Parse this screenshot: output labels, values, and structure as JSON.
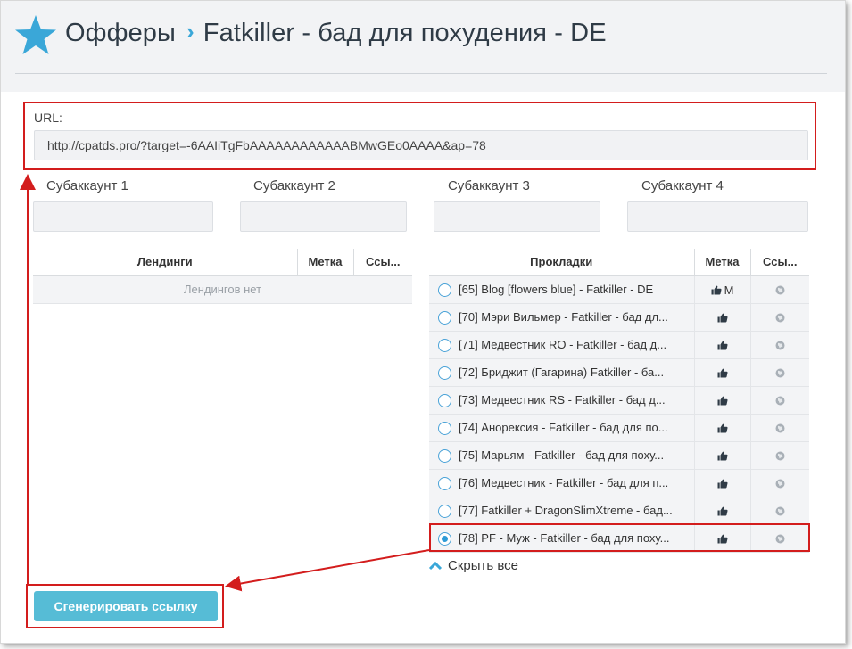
{
  "breadcrumb": {
    "root": "Офферы",
    "separator": "›",
    "current": "Fatkiller - бад для похудения - DE"
  },
  "url": {
    "label": "URL:",
    "value": "http://cpatds.pro/?target=-6AAIiTgFbAAAAAAAAAAAABMwGEo0AAAA&ap=78"
  },
  "subaccounts": [
    {
      "label": "Субаккаунт 1",
      "value": ""
    },
    {
      "label": "Субаккаунт 2",
      "value": ""
    },
    {
      "label": "Субаккаунт 3",
      "value": ""
    },
    {
      "label": "Субаккаунт 4",
      "value": ""
    }
  ],
  "landings": {
    "headers": [
      "Лендинги",
      "Метка",
      "Ссы..."
    ],
    "empty_text": "Лендингов нет"
  },
  "prelandings": {
    "headers": [
      "Прокладки",
      "Метка",
      "Ссы..."
    ],
    "rows": [
      {
        "name": "[65] Blog [flowers blue] - Fatkiller - DE",
        "mark": "M",
        "selected": false
      },
      {
        "name": "[70] Мэри Вильмер - Fatkiller - бад дл...",
        "mark": "",
        "selected": false
      },
      {
        "name": "[71] Медвестник RO - Fatkiller - бад д...",
        "mark": "",
        "selected": false
      },
      {
        "name": "[72] Бриджит (Гагарина) Fatkiller - ба...",
        "mark": "",
        "selected": false
      },
      {
        "name": "[73] Медвестник RS - Fatkiller - бад д...",
        "mark": "",
        "selected": false
      },
      {
        "name": "[74] Анорексия - Fatkiller - бад для по...",
        "mark": "",
        "selected": false
      },
      {
        "name": "[75] Марьям - Fatkiller - бад для поху...",
        "mark": "",
        "selected": false
      },
      {
        "name": "[76] Медвестник - Fatkiller - бад для п...",
        "mark": "",
        "selected": false
      },
      {
        "name": "[77] Fatkiller + DragonSlimXtreme - бад...",
        "mark": "",
        "selected": false
      },
      {
        "name": "[78] PF - Муж - Fatkiller - бад для поху...",
        "mark": "",
        "selected": true
      }
    ]
  },
  "hide_all_label": "Скрыть все",
  "generate_button": "Сгенерировать ссылку",
  "colors": {
    "accent": "#3aa7d8",
    "button": "#56bcd6",
    "highlight": "#d31d1d",
    "header_bg": "#f2f3f5"
  }
}
